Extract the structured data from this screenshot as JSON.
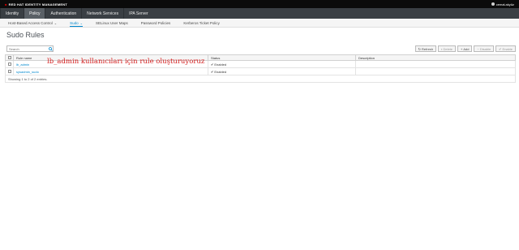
{
  "header": {
    "brand": "RED HAT IDENTITY MANAGEMENT",
    "user": "cemal.akyüz"
  },
  "nav": {
    "items": [
      {
        "label": "Identity"
      },
      {
        "label": "Policy"
      },
      {
        "label": "Authentication"
      },
      {
        "label": "Network Services"
      },
      {
        "label": "IPA Server"
      }
    ],
    "active": "Policy"
  },
  "subnav": {
    "items": [
      {
        "label": "Host-Based Access Control"
      },
      {
        "label": "Sudo"
      },
      {
        "label": "SELinux User Maps"
      },
      {
        "label": "Password Policies"
      },
      {
        "label": "Kerberos Ticket Policy"
      }
    ],
    "active": "Sudo"
  },
  "page": {
    "title": "Sudo Rules"
  },
  "search": {
    "placeholder": "Search",
    "icon": "search-icon"
  },
  "toolbar": {
    "refresh": "Refresh",
    "delete": "Delete",
    "add": "Add",
    "disable": "Disable",
    "enable": "Enable"
  },
  "table": {
    "columns": [
      "Rule name",
      "Status",
      "Description"
    ],
    "rows": [
      {
        "name": "lb_admin",
        "status": "Enabled",
        "description": ""
      },
      {
        "name": "sysadmin_sudo",
        "status": "Enabled",
        "description": ""
      }
    ],
    "footer": "Showing 1 to 2 of 2 entries."
  },
  "annotation": {
    "text": "lb_admin kullanıcıları için rule oluşturuyoruz"
  },
  "colors": {
    "nav_bg": "#3a3f44",
    "link": "#0088ce",
    "annotation": "#d42020"
  }
}
